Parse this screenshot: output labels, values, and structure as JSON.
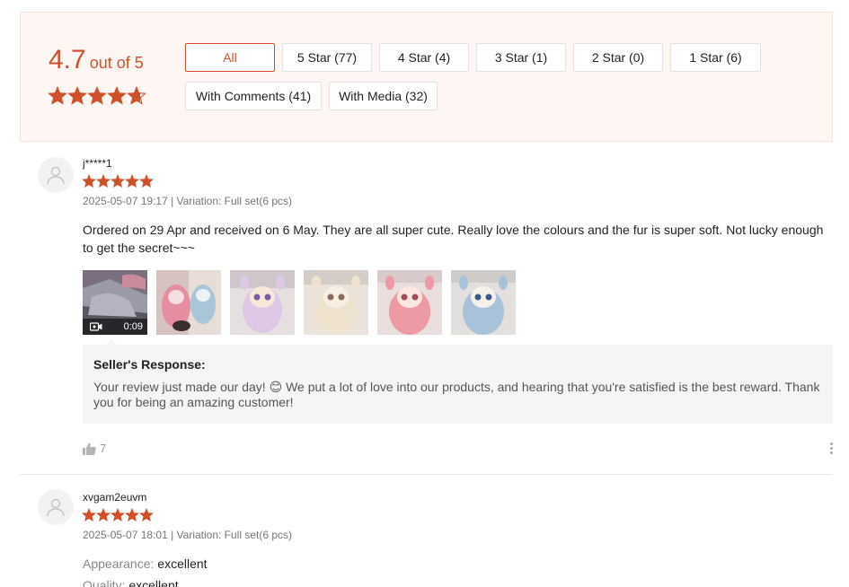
{
  "rating": {
    "score": "4.7",
    "out_of": "out of 5",
    "stars": 4.7,
    "accent_color": "#d0502b"
  },
  "filters": [
    {
      "label": "All",
      "active": true
    },
    {
      "label": "5 Star (77)",
      "active": false
    },
    {
      "label": "4 Star (4)",
      "active": false
    },
    {
      "label": "3 Star (1)",
      "active": false
    },
    {
      "label": "2 Star (0)",
      "active": false
    },
    {
      "label": "1 Star (6)",
      "active": false
    },
    {
      "label": "With Comments (41)",
      "active": false
    },
    {
      "label": "With Media (32)",
      "active": false
    }
  ],
  "reviews": [
    {
      "author": "j*****1",
      "stars": 5,
      "meta": "2025-05-07 19:17 | Variation: Full set(6 pcs)",
      "text": "Ordered on 29 Apr and received on 6 May. They are all super cute. Really love the colours and the fur is super soft. Not lucky  enough to get the secret~~~",
      "media": [
        {
          "type": "video",
          "duration": "0:09",
          "icon": "video-camera-icon",
          "color": "#4a4d58"
        },
        {
          "type": "photo",
          "color": "#d98c96"
        },
        {
          "type": "photo",
          "color": "#cdbfd8"
        },
        {
          "type": "photo",
          "color": "#d9c9b8"
        },
        {
          "type": "photo",
          "color": "#e69aa0"
        },
        {
          "type": "photo",
          "color": "#9fb7cf"
        }
      ],
      "seller_response": {
        "title": "Seller's Response:",
        "text": "Your review just made our day! 😊 We put a lot of love into our products, and hearing that you're satisfied is the best reward. Thank you for being an amazing customer!"
      },
      "likes": "7"
    },
    {
      "author": "xvgam2euvm",
      "stars": 5,
      "meta": "2025-05-07 18:01 | Variation: Full set(6 pcs)",
      "attributes": [
        {
          "key": "Appearance:",
          "value": "excellent"
        },
        {
          "key": "Quality:",
          "value": "excellent"
        }
      ]
    }
  ]
}
